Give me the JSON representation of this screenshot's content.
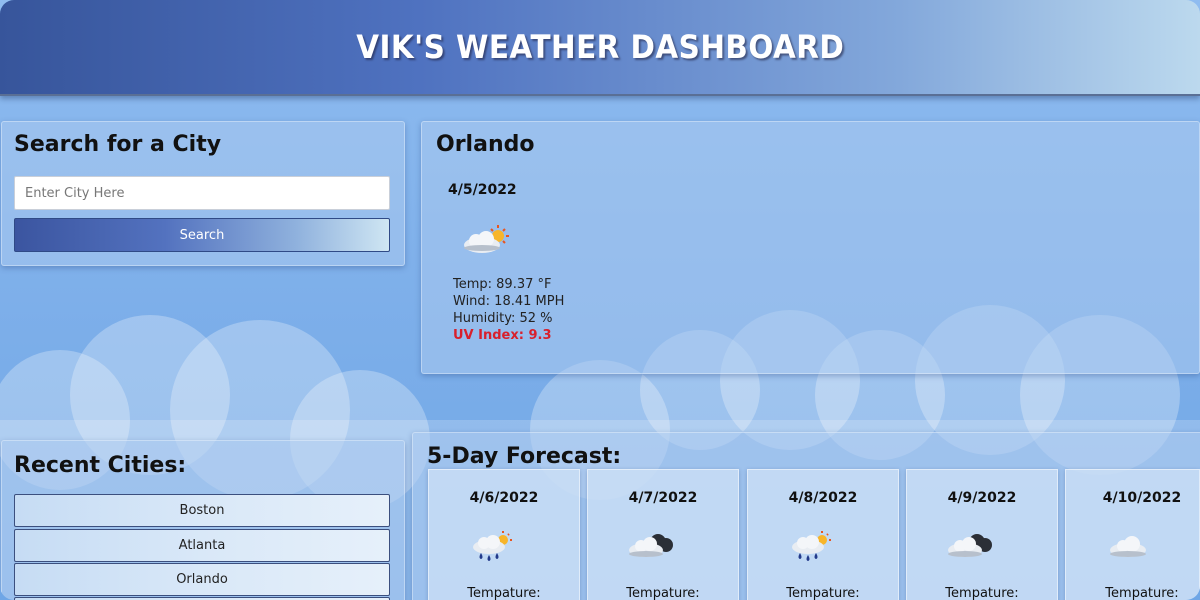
{
  "header": {
    "title": "VIK'S WEATHER DASHBOARD"
  },
  "search": {
    "title": "Search for a City",
    "placeholder": "Enter City Here",
    "button_label": "Search"
  },
  "current": {
    "city": "Orlando",
    "date": "4/5/2022",
    "icon": "partly-cloudy-sun-icon",
    "temp": "Temp: 89.37 °F",
    "wind": "Wind: 18.41 MPH",
    "humidity": "Humidity: 52 %",
    "uv": "UV Index: 9.3"
  },
  "recent": {
    "title": "Recent Cities:",
    "cities": [
      "Boston",
      "Atlanta",
      "Orlando"
    ]
  },
  "forecast": {
    "title": "5-Day Forecast:",
    "days": [
      {
        "date": "4/6/2022",
        "icon": "rain-sun-icon",
        "temp_label": "Tempature:"
      },
      {
        "date": "4/7/2022",
        "icon": "cloudy-icon",
        "temp_label": "Tempature:"
      },
      {
        "date": "4/8/2022",
        "icon": "rain-sun-icon",
        "temp_label": "Tempature:"
      },
      {
        "date": "4/9/2022",
        "icon": "cloudy-icon",
        "temp_label": "Tempature:"
      },
      {
        "date": "4/10/2022",
        "icon": "cloud-icon",
        "temp_label": "Tempature:"
      }
    ]
  },
  "colors": {
    "header_start": "#37559b",
    "header_end": "#bcd9ee",
    "uv_alert": "#d8202c",
    "sky": "#7fb0ea"
  }
}
